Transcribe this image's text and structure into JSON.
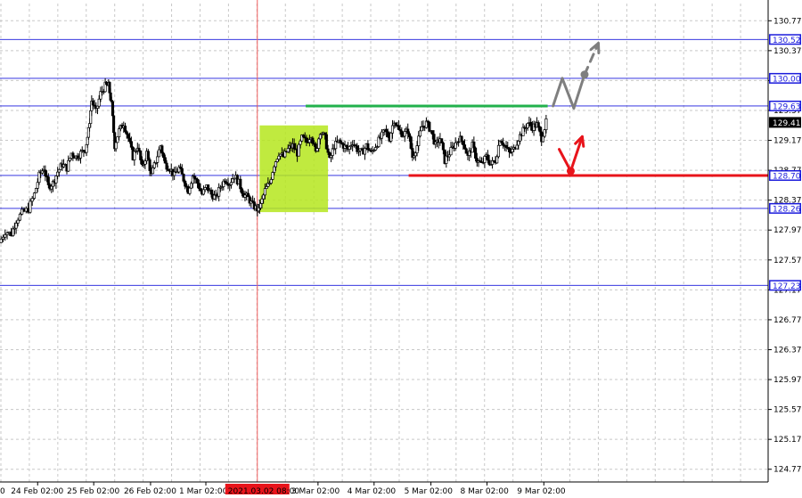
{
  "chart_data": {
    "type": "candlestick",
    "ylim": [
      124.6,
      131.0
    ],
    "grid": true,
    "y_ticks": [
      130.77,
      130.37,
      129.97,
      129.57,
      129.17,
      128.77,
      128.37,
      127.97,
      127.57,
      127.17,
      126.77,
      126.37,
      125.97,
      125.57,
      125.17,
      124.77
    ],
    "x_ticks": [
      {
        "label": "24 Feb 02:00",
        "pos": 0.049
      },
      {
        "label": "25 Feb 02:00",
        "pos": 0.122
      },
      {
        "label": "26 Feb 02:00",
        "pos": 0.196
      },
      {
        "label": "1 Mar 02:00",
        "pos": 0.268
      },
      {
        "label": "3 Mar 02:00",
        "pos": 0.414
      },
      {
        "label": "4 Mar 02:00",
        "pos": 0.487
      },
      {
        "label": "5 Mar 02:00",
        "pos": 0.561
      },
      {
        "label": "8 Mar 02:00",
        "pos": 0.634
      },
      {
        "label": "9 Mar 02:00",
        "pos": 0.708
      }
    ],
    "x_left_edge_label": "0",
    "cursor_time": {
      "label": "2021.03.02 08:00",
      "pos": 0.335
    },
    "current_price": 129.41,
    "levels": [
      {
        "value": 130.52,
        "label": "130.52"
      },
      {
        "value": 130.0,
        "label": "130.00"
      },
      {
        "value": 129.63,
        "label": "129.63"
      },
      {
        "value": 128.7,
        "label": "128.70"
      },
      {
        "value": 128.26,
        "label": "128.26"
      },
      {
        "value": 127.23,
        "label": "127.23"
      }
    ],
    "resistance": {
      "value": 129.63,
      "from": 0.398,
      "to": 0.713,
      "color": "#22b14c"
    },
    "support": {
      "value": 128.7,
      "from": 0.532,
      "to": 1.0,
      "color": "#e8141b"
    },
    "zone": {
      "from": 0.338,
      "to": 0.427,
      "top": 129.37,
      "bottom": 128.21,
      "color": "#b5e61d"
    },
    "price_path": [
      [
        0.0,
        127.8
      ],
      [
        0.008,
        127.95
      ],
      [
        0.016,
        127.92
      ],
      [
        0.022,
        128.1
      ],
      [
        0.03,
        128.2
      ],
      [
        0.038,
        128.25
      ],
      [
        0.046,
        128.45
      ],
      [
        0.052,
        128.7
      ],
      [
        0.058,
        128.8
      ],
      [
        0.064,
        128.55
      ],
      [
        0.07,
        128.6
      ],
      [
        0.076,
        128.75
      ],
      [
        0.082,
        128.85
      ],
      [
        0.088,
        128.8
      ],
      [
        0.094,
        129.0
      ],
      [
        0.1,
        128.95
      ],
      [
        0.106,
        129.0
      ],
      [
        0.112,
        129.05
      ],
      [
        0.116,
        129.3
      ],
      [
        0.12,
        129.7
      ],
      [
        0.126,
        129.55
      ],
      [
        0.132,
        129.8
      ],
      [
        0.138,
        129.9
      ],
      [
        0.142,
        129.9
      ],
      [
        0.146,
        129.65
      ],
      [
        0.15,
        129.1
      ],
      [
        0.156,
        129.3
      ],
      [
        0.162,
        129.4
      ],
      [
        0.168,
        129.2
      ],
      [
        0.174,
        128.95
      ],
      [
        0.18,
        129.1
      ],
      [
        0.186,
        128.8
      ],
      [
        0.192,
        129.0
      ],
      [
        0.198,
        128.7
      ],
      [
        0.204,
        128.9
      ],
      [
        0.21,
        129.1
      ],
      [
        0.216,
        128.85
      ],
      [
        0.222,
        128.8
      ],
      [
        0.228,
        128.7
      ],
      [
        0.234,
        128.8
      ],
      [
        0.24,
        128.65
      ],
      [
        0.246,
        128.5
      ],
      [
        0.252,
        128.7
      ],
      [
        0.258,
        128.6
      ],
      [
        0.264,
        128.45
      ],
      [
        0.27,
        128.55
      ],
      [
        0.276,
        128.45
      ],
      [
        0.282,
        128.4
      ],
      [
        0.288,
        128.55
      ],
      [
        0.294,
        128.65
      ],
      [
        0.3,
        128.6
      ],
      [
        0.306,
        128.7
      ],
      [
        0.312,
        128.6
      ],
      [
        0.318,
        128.45
      ],
      [
        0.324,
        128.4
      ],
      [
        0.33,
        128.3
      ],
      [
        0.336,
        128.25
      ],
      [
        0.34,
        128.3
      ],
      [
        0.346,
        128.5
      ],
      [
        0.352,
        128.6
      ],
      [
        0.358,
        128.85
      ],
      [
        0.364,
        129.0
      ],
      [
        0.37,
        128.95
      ],
      [
        0.376,
        129.05
      ],
      [
        0.382,
        129.1
      ],
      [
        0.388,
        129.0
      ],
      [
        0.394,
        129.2
      ],
      [
        0.4,
        129.15
      ],
      [
        0.406,
        129.25
      ],
      [
        0.412,
        129.0
      ],
      [
        0.418,
        129.3
      ],
      [
        0.424,
        129.2
      ],
      [
        0.43,
        128.9
      ],
      [
        0.436,
        129.1
      ],
      [
        0.442,
        129.15
      ],
      [
        0.448,
        129.1
      ],
      [
        0.454,
        129.05
      ],
      [
        0.46,
        129.15
      ],
      [
        0.466,
        129.05
      ],
      [
        0.472,
        129.0
      ],
      [
        0.478,
        129.1
      ],
      [
        0.484,
        129.0
      ],
      [
        0.49,
        129.1
      ],
      [
        0.496,
        129.2
      ],
      [
        0.502,
        129.3
      ],
      [
        0.508,
        129.2
      ],
      [
        0.514,
        129.45
      ],
      [
        0.52,
        129.3
      ],
      [
        0.526,
        129.25
      ],
      [
        0.532,
        129.3
      ],
      [
        0.538,
        128.95
      ],
      [
        0.544,
        129.1
      ],
      [
        0.55,
        129.35
      ],
      [
        0.556,
        129.4
      ],
      [
        0.562,
        129.3
      ],
      [
        0.568,
        129.1
      ],
      [
        0.574,
        129.2
      ],
      [
        0.58,
        128.9
      ],
      [
        0.586,
        129.0
      ],
      [
        0.592,
        129.1
      ],
      [
        0.598,
        129.2
      ],
      [
        0.604,
        129.15
      ],
      [
        0.61,
        128.95
      ],
      [
        0.616,
        129.1
      ],
      [
        0.622,
        128.9
      ],
      [
        0.628,
        128.85
      ],
      [
        0.634,
        128.95
      ],
      [
        0.64,
        128.85
      ],
      [
        0.646,
        128.9
      ],
      [
        0.652,
        129.2
      ],
      [
        0.658,
        129.1
      ],
      [
        0.664,
        129.0
      ],
      [
        0.67,
        129.05
      ],
      [
        0.676,
        129.2
      ],
      [
        0.682,
        129.3
      ],
      [
        0.688,
        129.4
      ],
      [
        0.694,
        129.35
      ],
      [
        0.7,
        129.38
      ],
      [
        0.706,
        129.2
      ],
      [
        0.712,
        129.41
      ]
    ],
    "scenarios": [
      {
        "color": "#7f7f7f",
        "points": [
          [
            0.72,
            129.63
          ],
          [
            0.732,
            130.0
          ],
          [
            0.747,
            129.6
          ],
          [
            0.761,
            130.05
          ],
          [
            0.779,
            130.47
          ]
        ],
        "dashed_from": 3,
        "dot_index": 3
      },
      {
        "color": "#e8141b",
        "points": [
          [
            0.728,
            129.05
          ],
          [
            0.743,
            128.76
          ],
          [
            0.758,
            129.22
          ]
        ],
        "dot_index": 1
      }
    ],
    "title": "",
    "xlabel": "",
    "ylabel": ""
  }
}
